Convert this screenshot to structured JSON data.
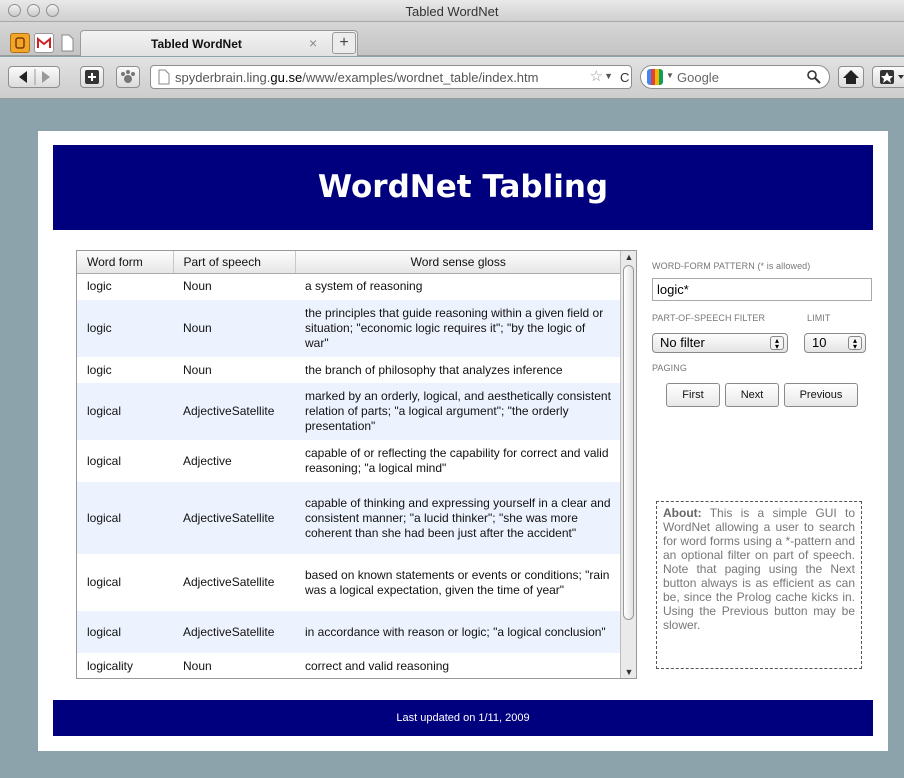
{
  "window": {
    "title": "Tabled WordNet"
  },
  "tabs": [
    {
      "label": "Tabled WordNet",
      "close": "×"
    }
  ],
  "tab_new_label": "+",
  "toolbar": {
    "url_prefix": "spyderbrain.ling.",
    "url_domain": "gu.se",
    "url_suffix": "/www/examples/wordnet_table/index.htm",
    "search_engine": "Google",
    "reload_label": "C"
  },
  "page": {
    "heading": "WordNet Tabling",
    "footer": "Last updated on 1/11, 2009"
  },
  "table": {
    "columns": [
      "Word form",
      "Part of speech",
      "Word sense gloss"
    ],
    "rows": [
      {
        "form": "logic",
        "pos": "Noun",
        "gloss": "a system of reasoning"
      },
      {
        "form": "logic",
        "pos": "Noun",
        "gloss": "the principles that guide reasoning within a given field or situation; \"economic logic requires it\"; \"by the logic of war\""
      },
      {
        "form": "logic",
        "pos": "Noun",
        "gloss": "the branch of philosophy that analyzes inference"
      },
      {
        "form": "logical",
        "pos": "AdjectiveSatellite",
        "gloss": "marked by an orderly, logical, and aesthetically consistent relation of parts; \"a logical argument\"; \"the orderly presentation\""
      },
      {
        "form": "logical",
        "pos": "Adjective",
        "gloss": "capable of or reflecting the capability for correct and valid reasoning; \"a logical mind\""
      },
      {
        "form": "logical",
        "pos": "AdjectiveSatellite",
        "gloss": "capable of thinking and expressing yourself in a clear and consistent manner; \"a lucid thinker\"; \"she was more coherent than she had been just after the accident\""
      },
      {
        "form": "logical",
        "pos": "AdjectiveSatellite",
        "gloss": "based on known statements or events or conditions; \"rain was a logical expectation, given the time of year\""
      },
      {
        "form": "logical",
        "pos": "AdjectiveSatellite",
        "gloss": "in accordance with reason or logic; \"a logical conclusion\""
      },
      {
        "form": "logicality",
        "pos": "Noun",
        "gloss": "correct and valid reasoning"
      }
    ]
  },
  "controls": {
    "pattern_label": "WORD-FORM PATTERN (* is allowed)",
    "pattern_value": "logic*",
    "pos_label": "PART-OF-SPEECH FILTER",
    "pos_value": "No filter",
    "limit_label": "LIMIT",
    "limit_value": "10",
    "paging_label": "PAGING",
    "first_label": "First",
    "next_label": "Next",
    "previous_label": "Previous"
  },
  "about": {
    "title": "About:",
    "text": "This is a simple GUI to WordNet allowing a user to search for word forms using a *-pattern and an optional filter on part of speech. Note that paging using the Next button always is as efficient as can be, since the Prolog cache kicks in. Using the Previous button may be slower."
  },
  "colors": {
    "banner": "#00007f",
    "page_bg": "#8da3ab",
    "row_alt": "#edf3fe"
  }
}
